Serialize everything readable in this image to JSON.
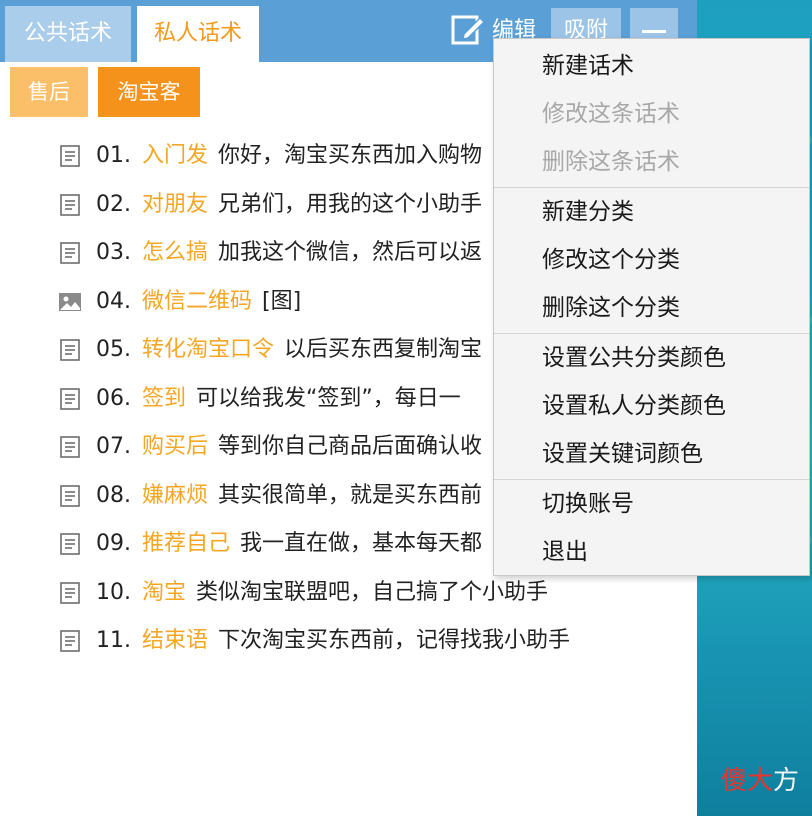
{
  "tabs": [
    {
      "label": "公共话术",
      "active": false
    },
    {
      "label": "私人话术",
      "active": true
    }
  ],
  "toolbar": {
    "edit_label": "编辑",
    "attach_label": "吸附",
    "edit_icon": "edit-pen-icon",
    "minimize_icon": "minimize-icon"
  },
  "categories": [
    {
      "label": "售后"
    },
    {
      "label": "淘宝客"
    }
  ],
  "phrases": [
    {
      "num": "01.",
      "keyword": "入门发",
      "text": "你好，淘宝买东西加入购物",
      "icon": "document-icon"
    },
    {
      "num": "02.",
      "keyword": "对朋友",
      "text": "兄弟们，用我的这个小助手",
      "icon": "document-icon"
    },
    {
      "num": "03.",
      "keyword": "怎么搞",
      "text": "加我这个微信，然后可以返",
      "icon": "document-icon"
    },
    {
      "num": "04.",
      "keyword": "微信二维码",
      "text": "[图]",
      "icon": "image-icon"
    },
    {
      "num": "05.",
      "keyword": "转化淘宝口令",
      "text": "以后买东西复制淘宝",
      "icon": "document-icon"
    },
    {
      "num": "06.",
      "keyword": "签到",
      "text": "可以给我发“签到”，每日一",
      "icon": "document-icon"
    },
    {
      "num": "07.",
      "keyword": "购买后",
      "text": "等到你自己商品后面确认收",
      "icon": "document-icon"
    },
    {
      "num": "08.",
      "keyword": "嫌麻烦",
      "text": "其实很简单，就是买东西前",
      "icon": "document-icon"
    },
    {
      "num": "09.",
      "keyword": "推荐自己",
      "text": "我一直在做，基本每天都",
      "icon": "document-icon"
    },
    {
      "num": "10.",
      "keyword": "淘宝",
      "text": "类似淘宝联盟吧，自己搞了个小助手",
      "icon": "document-icon"
    },
    {
      "num": "11.",
      "keyword": "结束语",
      "text": "下次淘宝买东西前，记得找我小助手",
      "icon": "document-icon"
    }
  ],
  "context_menu": [
    {
      "label": "新建话术",
      "enabled": true
    },
    {
      "label": "修改这条话术",
      "enabled": false
    },
    {
      "label": "删除这条话术",
      "enabled": false
    },
    {
      "label": "新建分类",
      "enabled": true
    },
    {
      "label": "修改这个分类",
      "enabled": true
    },
    {
      "label": "删除这个分类",
      "enabled": true
    },
    {
      "label": "设置公共分类颜色",
      "enabled": true
    },
    {
      "label": "设置私人分类颜色",
      "enabled": true
    },
    {
      "label": "设置关键词颜色",
      "enabled": true
    },
    {
      "label": "切换账号",
      "enabled": true
    },
    {
      "label": "退出",
      "enabled": true
    }
  ],
  "watermark": {
    "text": "傻大方"
  },
  "colors": {
    "header": "#5a9fd6",
    "keyword": "#f5a623",
    "chip_light": "#fbbf6a",
    "chip_dark": "#f5921c",
    "menu_disabled": "#a8a8a8"
  }
}
